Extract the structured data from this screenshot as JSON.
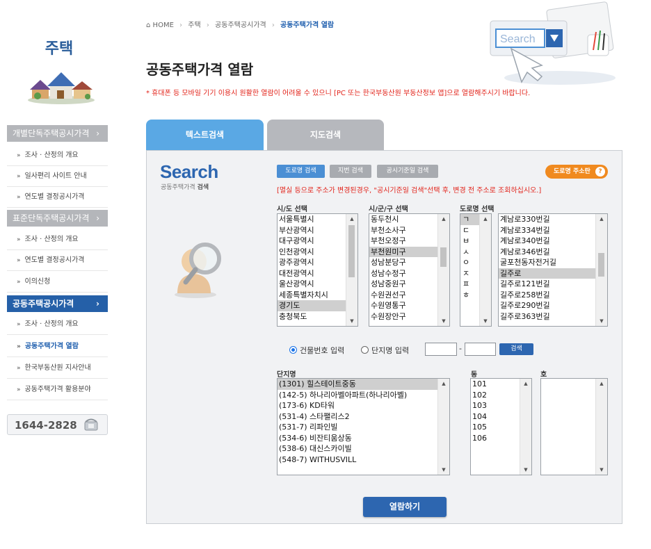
{
  "sidebar": {
    "title": "주택",
    "menus": [
      {
        "label": "개별단독주택공시가격",
        "arrow": "›"
      },
      {
        "label": "표준단독주택공시가격",
        "arrow": "›"
      },
      {
        "label": "공동주택공시가격",
        "arrow": "›"
      }
    ],
    "items_a": [
      "조사 · 산정의 개요",
      "일사편리 사이트 안내",
      "연도별 결정공시가격"
    ],
    "items_b": [
      "조사 · 산정의 개요",
      "연도별 결정공시가격",
      "이의신청"
    ],
    "items_c": [
      "조사 · 산정의 개요",
      "공동주택가격 열람",
      "한국부동산원 지사안내",
      "공동주택가격 활용분야"
    ],
    "bullet": "»",
    "phone": "1644-2828"
  },
  "breadcrumb": {
    "home": "HOME",
    "sep": "›",
    "items": [
      "주택",
      "공동주택공시가격"
    ],
    "current": "공동주택가격 열람"
  },
  "page": {
    "title": "공동주택가격 열람",
    "notice": "* 휴대폰 등 모바일 기기 이용시 원활한 열람이 어려울 수 있으니 [PC 또는 한국부동산원 부동산정보 앱]으로 열람해주시기 바랍니다."
  },
  "header_illust": {
    "search_text": "Search"
  },
  "tabs": [
    "텍스트검색",
    "지도검색"
  ],
  "search_panel": {
    "logo": "Search",
    "sub_normal": "공동주택가격",
    "sub_bold": "검색",
    "buttons": [
      "도로명 검색",
      "지번 검색",
      "공시기준일 검색"
    ],
    "road_info": "도로명 주소란",
    "road_info_q": "?",
    "red_notice": "[멸실 등으로 주소가 변경된경우, \"공시기준일 검색\"선택 후, 변경 전 주소로 조회하십시오.]"
  },
  "sido": {
    "label": "시/도 선택",
    "options": [
      "서울특별시",
      "부산광역시",
      "대구광역시",
      "인천광역시",
      "광주광역시",
      "대전광역시",
      "울산광역시",
      "세종특별자치시",
      "경기도",
      "충청북도"
    ],
    "selected": "경기도"
  },
  "sigungu": {
    "label": "시/군/구 선택",
    "options": [
      "동두천시",
      "부천소사구",
      "부천오정구",
      "부천원미구",
      "성남분당구",
      "성남수정구",
      "성남중원구",
      "수원권선구",
      "수원영통구",
      "수원장안구"
    ],
    "selected": "부천원미구"
  },
  "road": {
    "label": "도로명 선택",
    "initials": [
      "ㄱ",
      "ㄷ",
      "ㅂ",
      "ㅅ",
      "ㅇ",
      "ㅈ",
      "ㅍ",
      "ㅎ"
    ],
    "initial_selected": "ㄱ",
    "options": [
      "계남로330번길",
      "계남로334번길",
      "계남로340번길",
      "계남로346번길",
      "굴포천동자전거길",
      "길주로",
      "길주로121번길",
      "길주로258번길",
      "길주로290번길",
      "길주로363번길"
    ],
    "selected": "길주로"
  },
  "input_mode": {
    "building_label": "건물번호 입력",
    "complex_label": "단지명 입력",
    "selected": "building",
    "dash": "-",
    "search_btn": "검색"
  },
  "complex": {
    "label": "단지명",
    "options": [
      "(1301) 힐스테이트중동",
      "(142-5) 하나리아벨아파트(하나리아벨)",
      "(173-6) KD타워",
      "(531-4) 스타팰리스2",
      "(531-7) 리파인빌",
      "(534-6) 비잔티움상동",
      "(538-6) 대신스카이빌",
      "(548-7) WITHUSVILL"
    ],
    "selected": "(1301) 힐스테이트중동"
  },
  "dong": {
    "label": "동",
    "options": [
      "101",
      "102",
      "103",
      "104",
      "105",
      "106"
    ]
  },
  "ho": {
    "label": "호",
    "options": []
  },
  "view_button": "열람하기"
}
